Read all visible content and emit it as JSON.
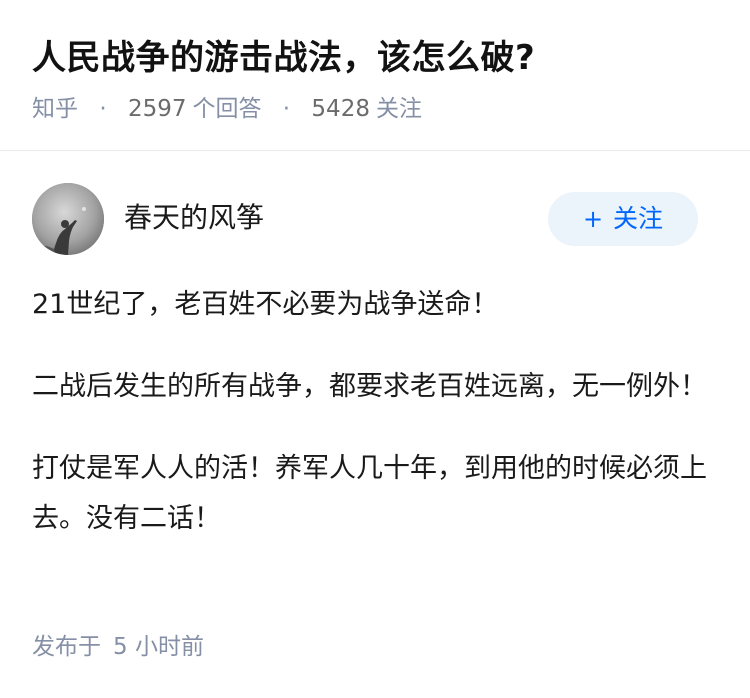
{
  "question": {
    "title": "人民战争的游击战法，该怎么破?",
    "source": "知乎",
    "separator": "·",
    "answer_count": "2597",
    "answer_label": "个回答",
    "follower_count": "5428",
    "follower_label": "关注"
  },
  "author": {
    "name": "春天的风筝",
    "avatar_icon": "user-avatar-photo",
    "follow_button": {
      "icon": "plus-icon",
      "icon_glyph": "+",
      "label": "关注"
    }
  },
  "answer": {
    "paragraphs": [
      "21世纪了，老百姓不必要为战争送命！",
      "二战后发生的所有战争，都要求老百姓远离，无一例外！",
      "打仗是军人人的活！养军人几十年，到用他的时候必须上去。没有二话！"
    ]
  },
  "meta": {
    "publish_label": "发布于",
    "publish_time": "5 小时前"
  },
  "colors": {
    "accent": "#0066ff",
    "follow_bg": "#ebf3fb",
    "meta_text": "#8590a6",
    "title_text": "#121212"
  }
}
